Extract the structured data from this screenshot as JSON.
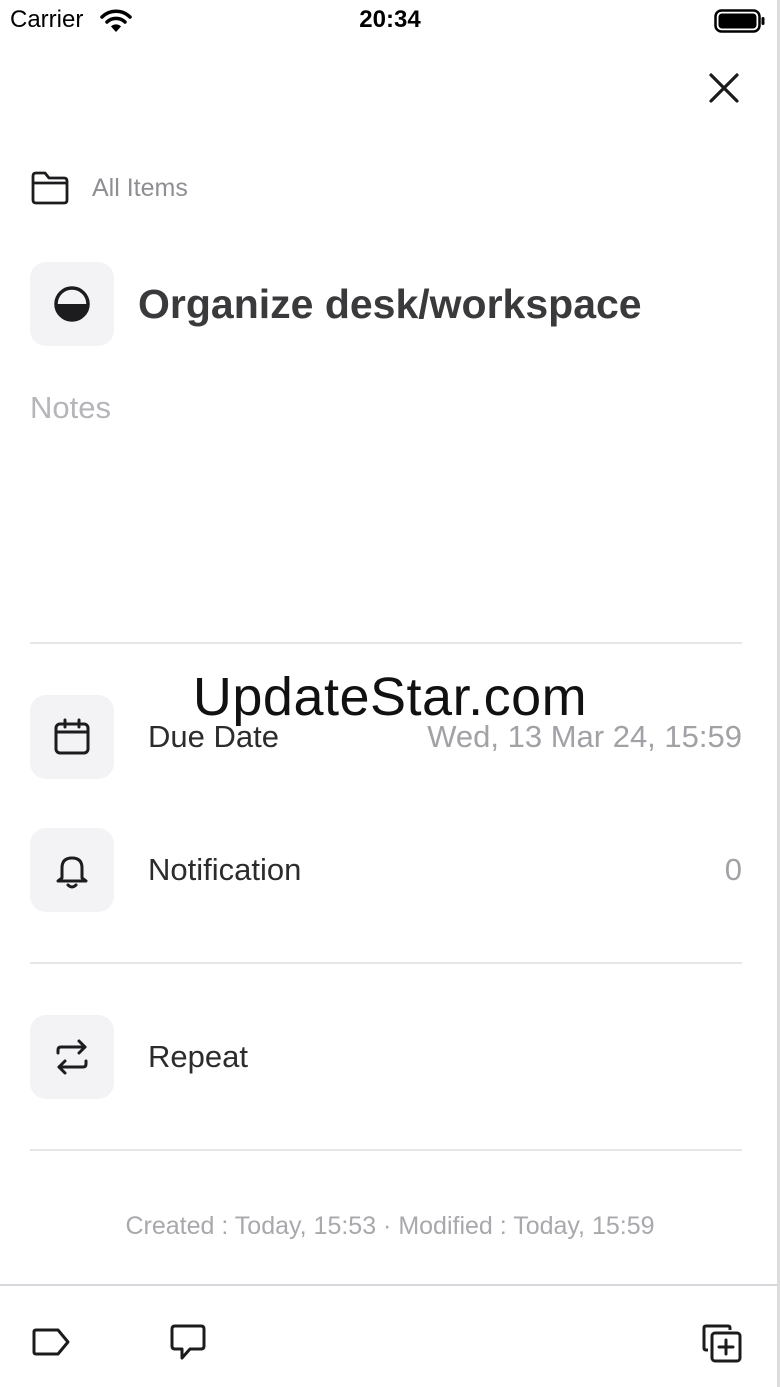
{
  "status_bar": {
    "carrier": "Carrier",
    "time": "20:34",
    "wifi_icon": "wifi-icon",
    "battery_icon": "battery-icon"
  },
  "header": {
    "close_icon": "close-icon"
  },
  "folder": {
    "icon": "folder-icon",
    "label": "All Items"
  },
  "task": {
    "status_icon": "half-circle-progress-icon",
    "title": "Organize desk/workspace",
    "notes_placeholder": "Notes"
  },
  "options": [
    {
      "icon": "calendar-icon",
      "label": "Due Date",
      "value": "Wed, 13 Mar 24, 15:59"
    },
    {
      "icon": "bell-icon",
      "label": "Notification",
      "value": "0"
    },
    {
      "icon": "repeat-icon",
      "label": "Repeat",
      "value": ""
    }
  ],
  "watermark": "UpdateStar.com",
  "meta": "Created : Today, 15:53 · Modified : Today, 15:59",
  "bottom_bar": {
    "tag_icon": "tag-icon",
    "comment_icon": "comment-icon",
    "duplicate_icon": "duplicate-icon"
  },
  "colors": {
    "tile_background": "#f3f3f5",
    "secondary_text": "#8e8e93",
    "placeholder_text": "#b5b5ba",
    "divider": "#e6e6e8"
  }
}
